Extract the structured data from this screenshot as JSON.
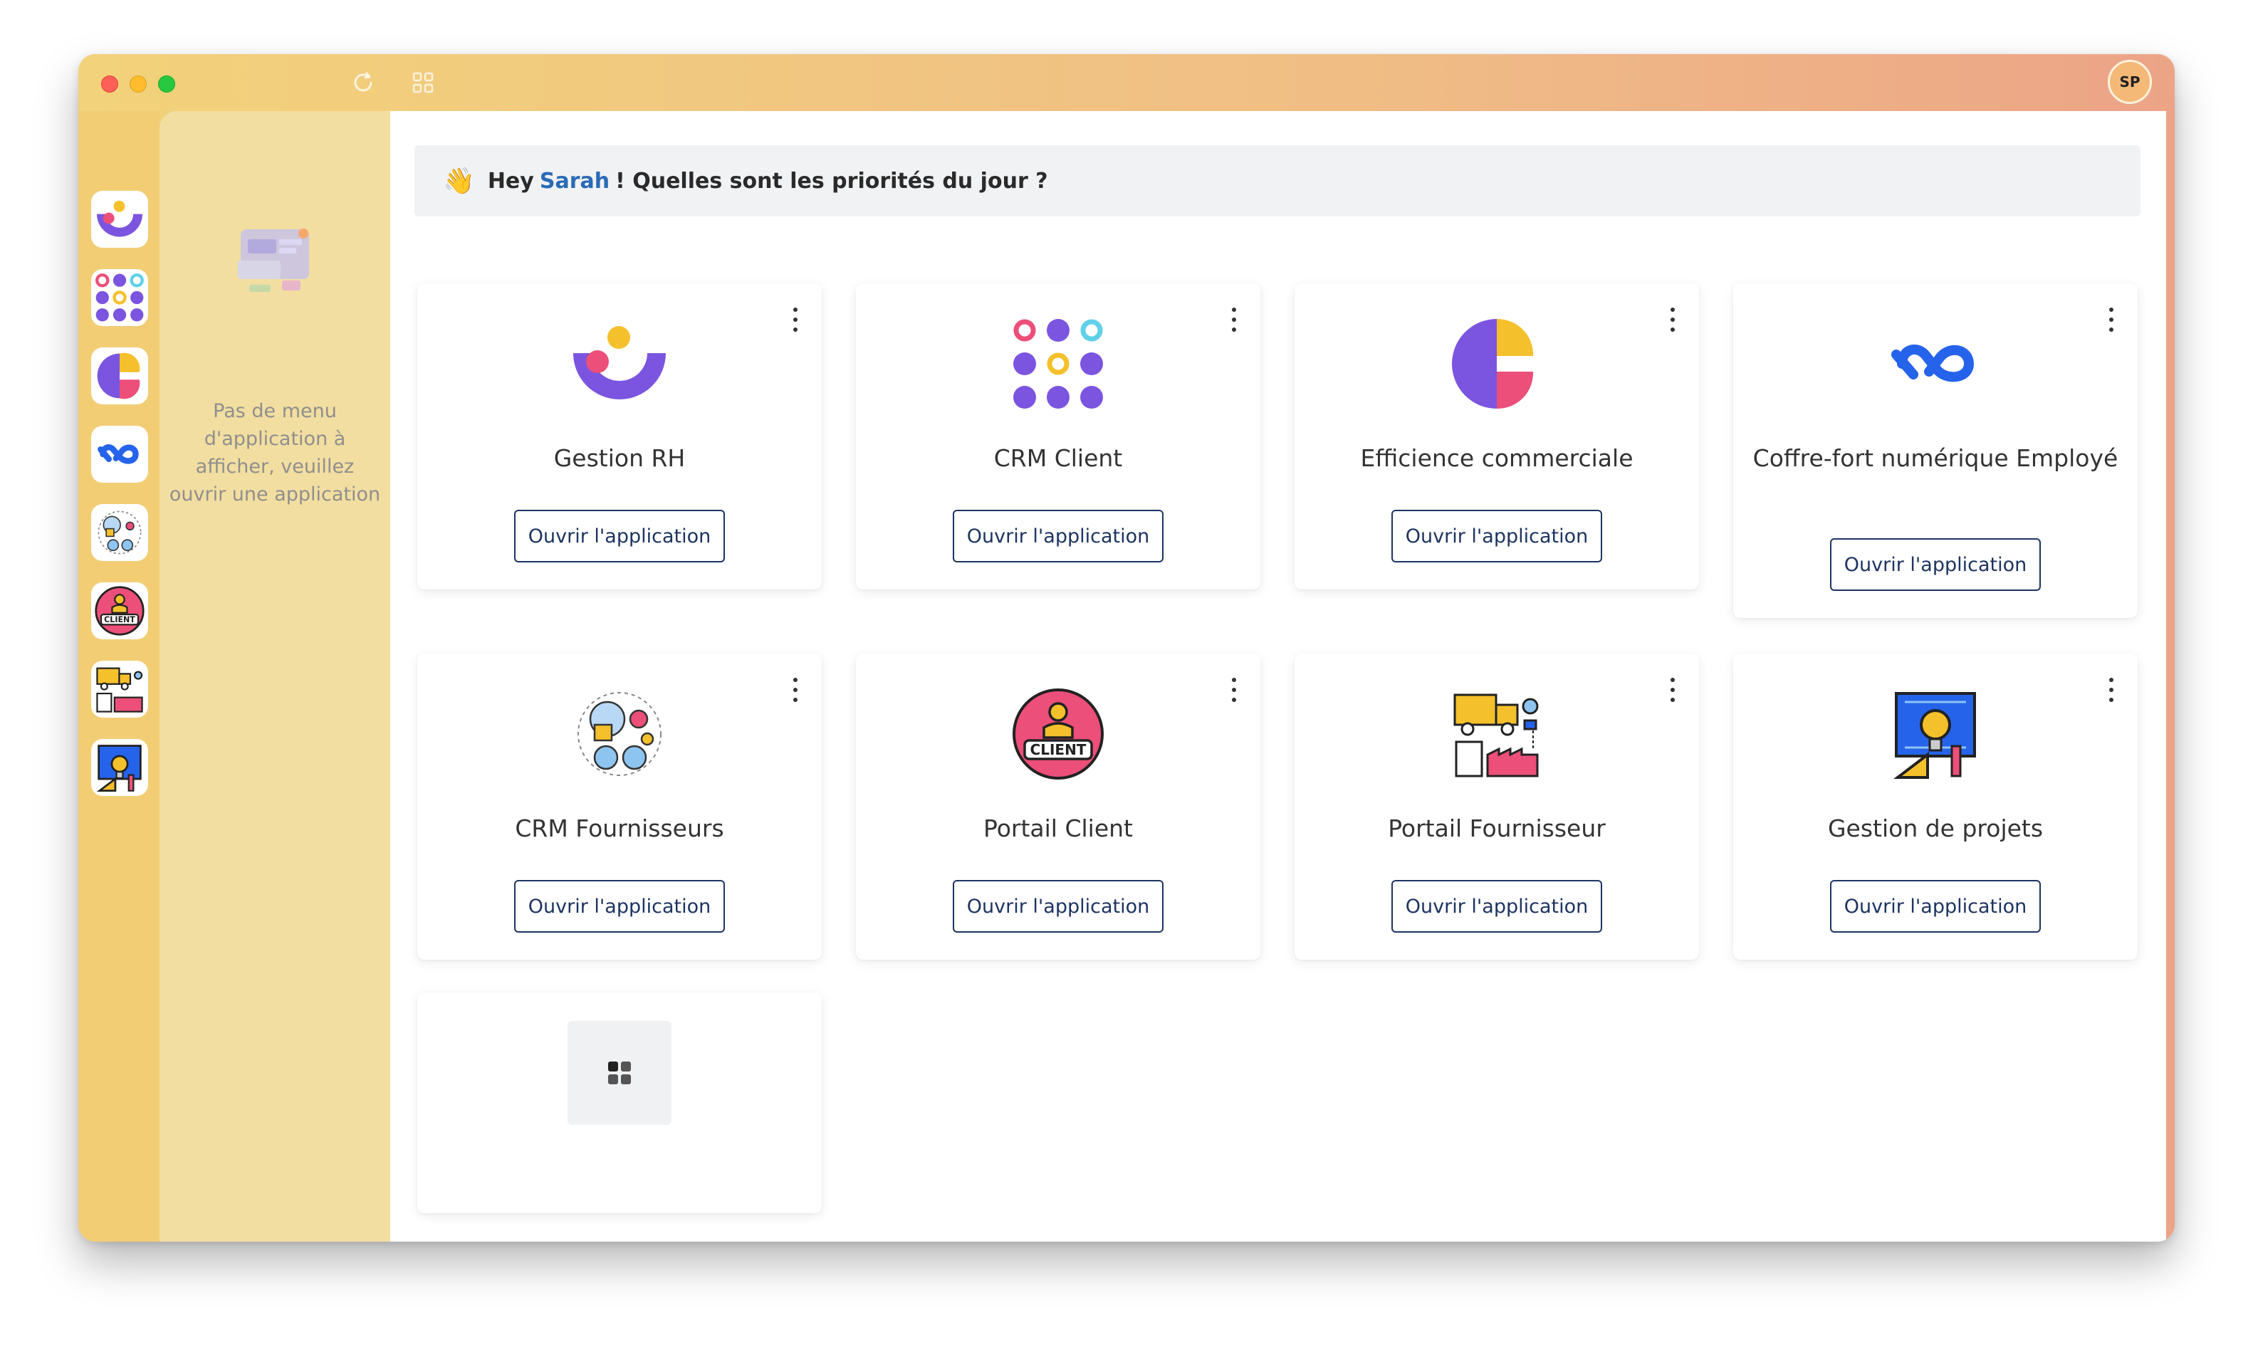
{
  "topbar": {
    "avatar_initials": "SP",
    "refresh_icon": "refresh-icon",
    "apps_grid_icon": "grid-icon"
  },
  "rail": {
    "items": [
      {
        "name": "gestion-rh"
      },
      {
        "name": "crm-client"
      },
      {
        "name": "efficience-commerciale"
      },
      {
        "name": "coffre-fort"
      },
      {
        "name": "crm-fournisseurs"
      },
      {
        "name": "portail-client"
      },
      {
        "name": "portail-fournisseur"
      },
      {
        "name": "gestion-projets"
      }
    ]
  },
  "panel": {
    "empty_message": "Pas de menu d'application à afficher, veuillez ouvrir une application"
  },
  "greeting": {
    "emoji": "👋",
    "prefix": "Hey",
    "name": "Sarah",
    "suffix": "! Quelles sont les priorités du jour ?"
  },
  "apps": [
    {
      "title": "Gestion RH",
      "button": "Ouvrir l'application"
    },
    {
      "title": "CRM Client",
      "button": "Ouvrir l'application"
    },
    {
      "title": "Efficience commerciale",
      "button": "Ouvrir l'application"
    },
    {
      "title": "Coffre-fort numérique Employé",
      "button": "Ouvrir l'application"
    },
    {
      "title": "CRM Fournisseurs",
      "button": "Ouvrir l'application"
    },
    {
      "title": "Portail Client",
      "button": "Ouvrir l'application"
    },
    {
      "title": "Portail Fournisseur",
      "button": "Ouvrir l'application"
    },
    {
      "title": "Gestion de projets",
      "button": "Ouvrir l'application"
    }
  ],
  "portail_client_badge": "CLIENT",
  "colors": {
    "accent_name": "#2a6bb5",
    "button_border": "#1d3461",
    "purple": "#7b55e0",
    "pink": "#ec4f79",
    "yellow": "#f4c02b",
    "blue": "#2563eb"
  }
}
